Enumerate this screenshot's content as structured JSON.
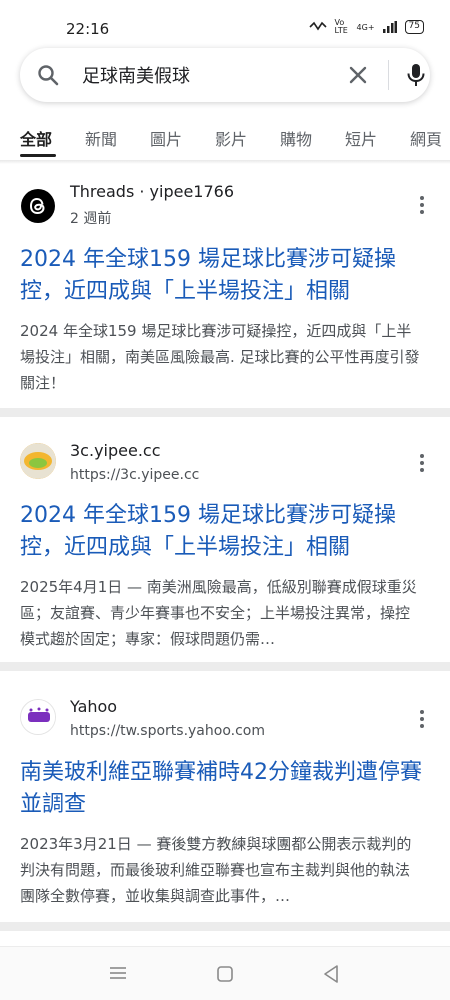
{
  "status": {
    "time": "22:16",
    "network": "4G+",
    "volte": "Vo LTE",
    "battery": "75"
  },
  "search": {
    "query": "足球南美假球"
  },
  "tabs": [
    {
      "label": "全部",
      "active": true
    },
    {
      "label": "新聞"
    },
    {
      "label": "圖片"
    },
    {
      "label": "影片"
    },
    {
      "label": "購物"
    },
    {
      "label": "短片"
    },
    {
      "label": "網頁"
    }
  ],
  "results": [
    {
      "site": "Threads · yipee1766",
      "sub": "2 週前",
      "title": "2024 年全球159 場足球比賽涉可疑操控，近四成與「上半場投注」相關",
      "snippet": "2024 年全球159 場足球比賽涉可疑操控，近四成與「上半場投注」相關，南美區風險最高. 足球比賽的公平性再度引發關注！"
    },
    {
      "site": "3c.yipee.cc",
      "sub": "https://3c.yipee.cc",
      "title": "2024 年全球159 場足球比賽涉可疑操控，近四成與「上半場投注」相關",
      "snippet": "2025年4月1日 — 南美洲風險最高，低級別聯賽成假球重災區；友誼賽、青少年賽事也不安全；上半場投注異常，操控模式趨於固定；專家：假球問題仍需…"
    },
    {
      "site": "Yahoo",
      "sub": "https://tw.sports.yahoo.com",
      "title": "南美玻利維亞聯賽補時42分鐘裁判遭停賽並調查",
      "snippet": "2023年3月21日 — 賽後雙方教練與球團都公開表示裁判的判決有問題，而最後玻利維亞聯賽也宣布主裁判與他的執法團隊全數停賽，並收集與調查此事件，…"
    }
  ],
  "icons": {
    "search": "search-icon",
    "clear": "close-icon",
    "mic": "microphone-icon",
    "more": "more-vert-icon",
    "nav_menu": "menu-icon",
    "nav_home": "home-icon",
    "nav_back": "back-icon"
  },
  "colors": {
    "link": "#1a5bb8",
    "snippet": "#4d5156",
    "separator": "#ececec"
  }
}
